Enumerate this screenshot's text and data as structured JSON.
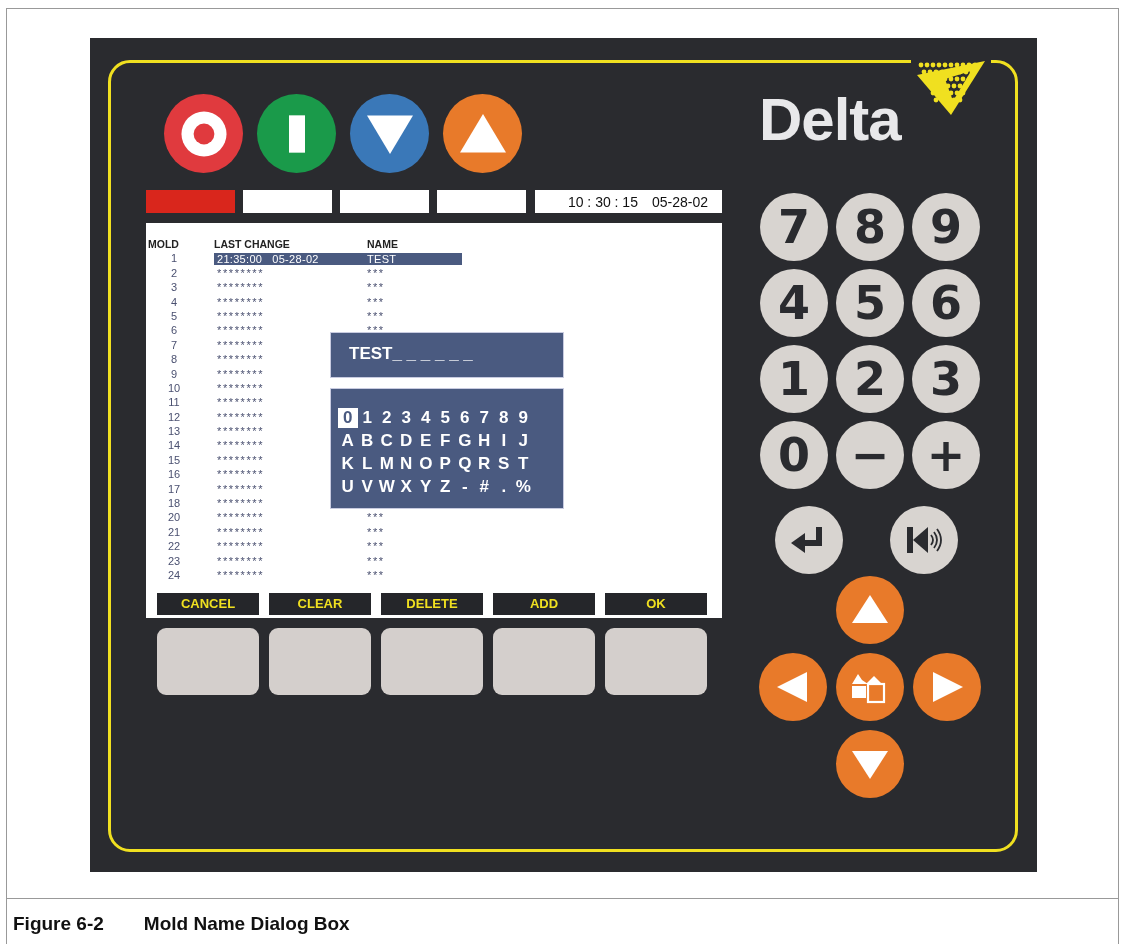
{
  "panel": {
    "top_buttons": [
      {
        "kind": "stop"
      },
      {
        "kind": "start"
      },
      {
        "kind": "down"
      },
      {
        "kind": "up"
      }
    ],
    "indicators": [
      {
        "on": true
      },
      {
        "on": false
      },
      {
        "on": false
      },
      {
        "on": false
      }
    ],
    "clock": {
      "time": "10 : 30 : 15",
      "date": "05-28-02"
    },
    "logo": {
      "text": "Delta"
    },
    "keypad": [
      {
        "label": "7"
      },
      {
        "label": "8"
      },
      {
        "label": "9"
      },
      {
        "label": "4"
      },
      {
        "label": "5"
      },
      {
        "label": "6"
      },
      {
        "label": "1"
      },
      {
        "label": "2"
      },
      {
        "label": "3"
      },
      {
        "label": "0"
      },
      {
        "label": "−"
      },
      {
        "label": "+"
      }
    ],
    "keypad_extra": [
      {
        "kind": "enter"
      },
      {
        "kind": "sound"
      }
    ],
    "nav": [
      {
        "kind": "up"
      },
      {
        "kind": "left"
      },
      {
        "kind": "home"
      },
      {
        "kind": "right"
      },
      {
        "kind": "down"
      }
    ],
    "softkeys": [
      {
        "label": "CANCEL"
      },
      {
        "label": "CLEAR"
      },
      {
        "label": "DELETE"
      },
      {
        "label": "ADD"
      },
      {
        "label": "OK"
      }
    ]
  },
  "table": {
    "columns": [
      "MOLD",
      "LAST CHANGE",
      "NAME"
    ],
    "rows": [
      {
        "mold": "1",
        "last_change": "21:35:00   05-28-02",
        "name": "TEST",
        "selected": true
      },
      {
        "mold": "2",
        "last_change": "********",
        "name": "***",
        "selected": false
      },
      {
        "mold": "3",
        "last_change": "********",
        "name": "***",
        "selected": false
      },
      {
        "mold": "4",
        "last_change": "********",
        "name": "***",
        "selected": false
      },
      {
        "mold": "5",
        "last_change": "********",
        "name": "***",
        "selected": false
      },
      {
        "mold": "6",
        "last_change": "********",
        "name": "***",
        "selected": false
      },
      {
        "mold": "7",
        "last_change": "********",
        "selected": false
      },
      {
        "mold": "8",
        "last_change": "********",
        "selected": false
      },
      {
        "mold": "9",
        "last_change": "********",
        "selected": false
      },
      {
        "mold": "10",
        "last_change": "********",
        "selected": false
      },
      {
        "mold": "11",
        "last_change": "********",
        "selected": false
      },
      {
        "mold": "12",
        "last_change": "********",
        "selected": false
      },
      {
        "mold": "13",
        "last_change": "********",
        "selected": false
      },
      {
        "mold": "14",
        "last_change": "********",
        "selected": false
      },
      {
        "mold": "15",
        "last_change": "********",
        "selected": false
      },
      {
        "mold": "16",
        "last_change": "********",
        "selected": false
      },
      {
        "mold": "17",
        "last_change": "********",
        "selected": false
      },
      {
        "mold": "18",
        "last_change": "********",
        "selected": false
      },
      {
        "mold": "20",
        "last_change": "********",
        "name": "***",
        "selected": false
      },
      {
        "mold": "21",
        "last_change": "********",
        "name": "***",
        "selected": false
      },
      {
        "mold": "22",
        "last_change": "********",
        "name": "***",
        "selected": false
      },
      {
        "mold": "23",
        "last_change": "********",
        "name": "***",
        "selected": false
      },
      {
        "mold": "24",
        "last_change": "********",
        "name": "***",
        "selected": false
      }
    ]
  },
  "dialog": {
    "entry": "TEST_ _ _ _ _ _",
    "characters": [
      [
        {
          "char": "0",
          "selected": true
        },
        {
          "char": "1",
          "selected": false
        },
        {
          "char": "2",
          "selected": false
        },
        {
          "char": "3",
          "selected": false
        },
        {
          "char": "4",
          "selected": false
        },
        {
          "char": "5",
          "selected": false
        },
        {
          "char": "6",
          "selected": false
        },
        {
          "char": "7",
          "selected": false
        },
        {
          "char": "8",
          "selected": false
        },
        {
          "char": "9",
          "selected": false
        }
      ],
      [
        {
          "char": "A",
          "selected": false
        },
        {
          "char": "B",
          "selected": false
        },
        {
          "char": "C",
          "selected": false
        },
        {
          "char": "D",
          "selected": false
        },
        {
          "char": "E",
          "selected": false
        },
        {
          "char": "F",
          "selected": false
        },
        {
          "char": "G",
          "selected": false
        },
        {
          "char": "H",
          "selected": false
        },
        {
          "char": "I",
          "selected": false
        },
        {
          "char": "J",
          "selected": false
        }
      ],
      [
        {
          "char": "K",
          "selected": false
        },
        {
          "char": "L",
          "selected": false
        },
        {
          "char": "M",
          "selected": false
        },
        {
          "char": "N",
          "selected": false
        },
        {
          "char": "O",
          "selected": false
        },
        {
          "char": "P",
          "selected": false
        },
        {
          "char": "Q",
          "selected": false
        },
        {
          "char": "R",
          "selected": false
        },
        {
          "char": "S",
          "selected": false
        },
        {
          "char": "T",
          "selected": false
        }
      ],
      [
        {
          "char": "U",
          "selected": false
        },
        {
          "char": "V",
          "selected": false
        },
        {
          "char": "W",
          "selected": false
        },
        {
          "char": "X",
          "selected": false
        },
        {
          "char": "Y",
          "selected": false
        },
        {
          "char": "Z",
          "selected": false
        },
        {
          "char": "-",
          "selected": false
        },
        {
          "char": "#",
          "selected": false
        },
        {
          "char": ".",
          "selected": false
        },
        {
          "char": "%",
          "selected": false
        }
      ]
    ]
  },
  "caption": {
    "number": "Figure 6-2",
    "title": "Mold Name Dialog Box"
  }
}
